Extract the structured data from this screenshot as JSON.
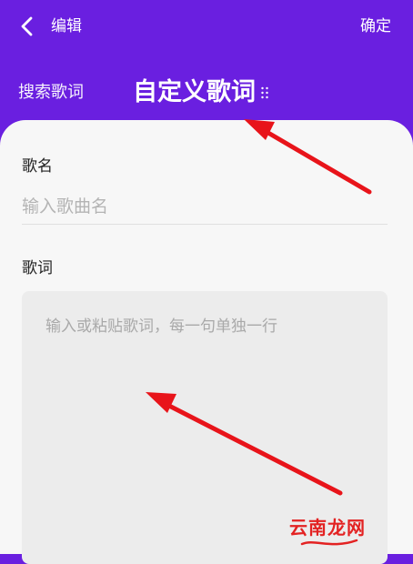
{
  "header": {
    "back_icon": "chevron-left-icon",
    "title": "编辑",
    "confirm_label": "确定"
  },
  "tabs": [
    {
      "label": "搜索歌词",
      "active": false
    },
    {
      "label": "自定义歌词",
      "active": true
    }
  ],
  "form": {
    "song_name_label": "歌名",
    "song_name_placeholder": "输入歌曲名",
    "song_name_value": "",
    "lyrics_label": "歌词",
    "lyrics_placeholder": "输入或粘贴歌词，每一句单独一行",
    "lyrics_value": ""
  },
  "watermark": "云南龙网",
  "colors": {
    "accent": "#6A1FE0",
    "sheet_bg": "#F7F7F7",
    "annotation_arrow": "#E8141A"
  }
}
